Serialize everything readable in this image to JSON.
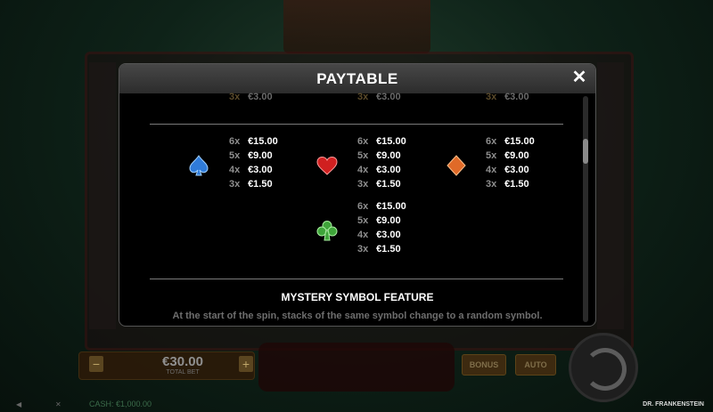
{
  "paytable": {
    "title": "PAYTABLE",
    "top_partial": [
      {
        "count": "3x",
        "amount": "€3.00"
      },
      {
        "count": "3x",
        "amount": "€3.00"
      },
      {
        "count": "3x",
        "amount": "€3.00"
      }
    ],
    "symbols": [
      {
        "name": "spade",
        "color": "#2f7bd9",
        "pays": [
          {
            "count": "6x",
            "amount": "€15.00"
          },
          {
            "count": "5x",
            "amount": "€9.00"
          },
          {
            "count": "4x",
            "amount": "€3.00"
          },
          {
            "count": "3x",
            "amount": "€1.50"
          }
        ]
      },
      {
        "name": "heart",
        "color": "#d02020",
        "pays": [
          {
            "count": "6x",
            "amount": "€15.00"
          },
          {
            "count": "5x",
            "amount": "€9.00"
          },
          {
            "count": "4x",
            "amount": "€3.00"
          },
          {
            "count": "3x",
            "amount": "€1.50"
          }
        ]
      },
      {
        "name": "diamond",
        "color": "#e06a28",
        "pays": [
          {
            "count": "6x",
            "amount": "€15.00"
          },
          {
            "count": "5x",
            "amount": "€9.00"
          },
          {
            "count": "4x",
            "amount": "€3.00"
          },
          {
            "count": "3x",
            "amount": "€1.50"
          }
        ]
      },
      {
        "name": "club",
        "color": "#3fa53a",
        "pays": [
          {
            "count": "6x",
            "amount": "€15.00"
          },
          {
            "count": "5x",
            "amount": "€9.00"
          },
          {
            "count": "4x",
            "amount": "€3.00"
          },
          {
            "count": "3x",
            "amount": "€1.50"
          }
        ]
      }
    ],
    "feature_title": "MYSTERY SYMBOL FEATURE",
    "feature_desc": "At the start of the spin, stacks of the same symbol change to a random symbol."
  },
  "bottom_bar": {
    "bet_value": "€30.00",
    "bet_label": "TOTAL BET",
    "bonus_label": "BONUS",
    "auto_label": "AUTO",
    "cash_label": "CASH: €1,000.00",
    "game_title": "DR. FRANKENSTEIN"
  },
  "colors": {
    "modal_bg": "#000000",
    "header": "#3a3a3a",
    "text": "#ffffff",
    "muted": "#8e8e8e"
  }
}
